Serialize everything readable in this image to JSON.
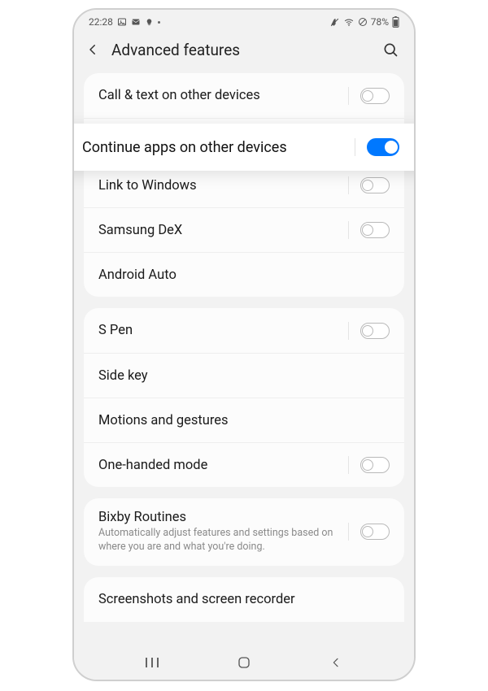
{
  "status": {
    "time": "22:28",
    "battery": "78%"
  },
  "header": {
    "title": "Advanced features"
  },
  "highlight": {
    "label": "Continue apps on other devices",
    "on": true
  },
  "groups": [
    {
      "items": [
        {
          "key": "call-text",
          "label": "Call & text on other devices",
          "toggle": true,
          "on": false
        },
        {
          "key": "spacer",
          "spacer": true
        },
        {
          "key": "link-win",
          "label": "Link to Windows",
          "toggle": true,
          "on": false
        },
        {
          "key": "dex",
          "label": "Samsung DeX",
          "toggle": true,
          "on": false
        },
        {
          "key": "android-auto",
          "label": "Android Auto",
          "toggle": false
        }
      ]
    },
    {
      "items": [
        {
          "key": "s-pen",
          "label": "S Pen",
          "toggle": true,
          "on": false
        },
        {
          "key": "side-key",
          "label": "Side key",
          "toggle": false
        },
        {
          "key": "motions",
          "label": "Motions and gestures",
          "toggle": false
        },
        {
          "key": "one-hand",
          "label": "One-handed mode",
          "toggle": true,
          "on": false
        }
      ]
    },
    {
      "items": [
        {
          "key": "bixby",
          "label": "Bixby Routines",
          "sub": "Automatically adjust features and settings based on where you are and what you're doing.",
          "toggle": true,
          "on": false
        }
      ]
    },
    {
      "items": [
        {
          "key": "screenshots",
          "label": "Screenshots and screen recorder",
          "toggle": false
        }
      ],
      "cut": true
    }
  ]
}
